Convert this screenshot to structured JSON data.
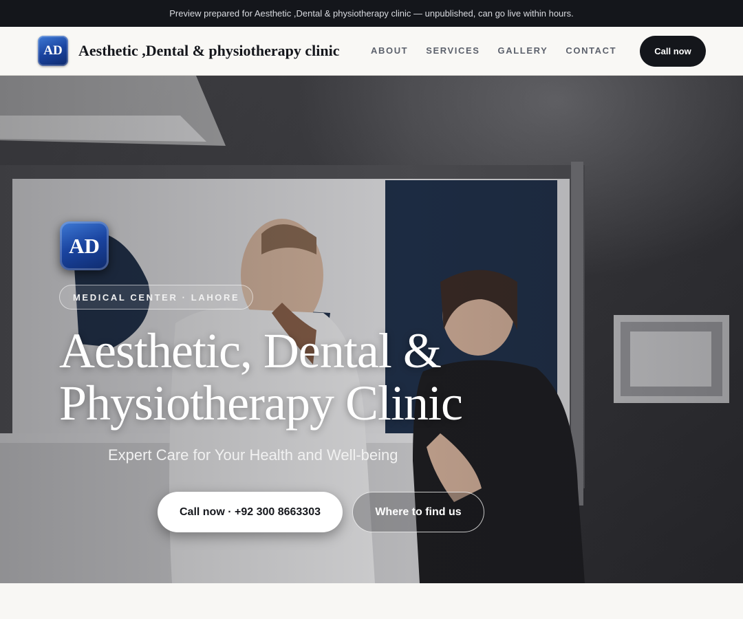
{
  "banner": {
    "text": "Preview prepared for Aesthetic ,Dental & physiotherapy clinic — unpublished, can go live within hours."
  },
  "header": {
    "logo_text": "AD",
    "brand_name": "Aesthetic ,Dental & physiotherapy clinic",
    "nav": [
      {
        "label": "ABOUT"
      },
      {
        "label": "SERVICES"
      },
      {
        "label": "GALLERY"
      },
      {
        "label": "CONTACT"
      }
    ],
    "cta_label": "Call now"
  },
  "hero": {
    "logo_text": "AD",
    "badge": "MEDICAL CENTER · LAHORE",
    "title_line1": "Aesthetic, Dental &",
    "title_line2": "Physiotherapy Clinic",
    "subtitle": "Expert Care for Your Health and Well-being",
    "primary_button": "Call now · +92 300 8663303",
    "secondary_button": "Where to find us"
  },
  "colors": {
    "topbar_bg": "#14161b",
    "nav_bg": "#f9f8f5",
    "cta_bg": "#14161b",
    "logo_blue": "#1a44a0"
  }
}
